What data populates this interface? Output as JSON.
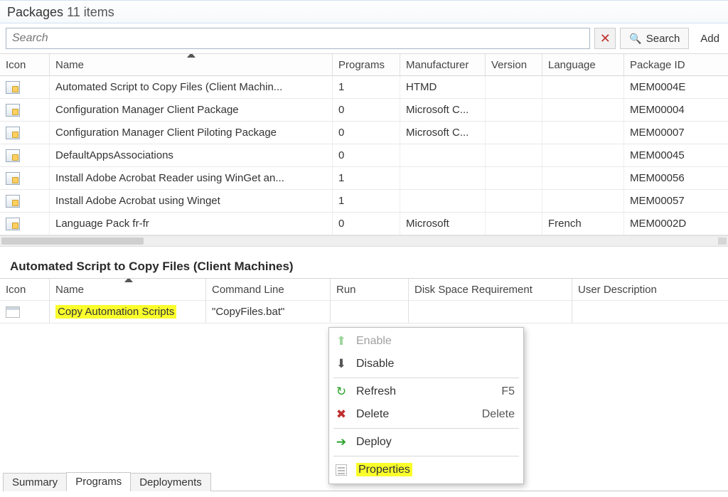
{
  "header": {
    "title": "Packages",
    "count_label": "11 items"
  },
  "search": {
    "placeholder": "Search",
    "clear_icon": "✕",
    "search_button": "Search",
    "add_link": "Add"
  },
  "columns": {
    "icon": "Icon",
    "name": "Name",
    "programs": "Programs",
    "manufacturer": "Manufacturer",
    "version": "Version",
    "language": "Language",
    "package_id": "Package ID"
  },
  "packages": [
    {
      "name": "Automated Script to Copy Files (Client Machin...",
      "programs": "1",
      "manufacturer": "HTMD",
      "version": "",
      "language": "",
      "package_id": "MEM0004E"
    },
    {
      "name": "Configuration Manager Client Package",
      "programs": "0",
      "manufacturer": "Microsoft C...",
      "version": "",
      "language": "",
      "package_id": "MEM00004"
    },
    {
      "name": "Configuration Manager Client Piloting Package",
      "programs": "0",
      "manufacturer": "Microsoft C...",
      "version": "",
      "language": "",
      "package_id": "MEM00007"
    },
    {
      "name": "DefaultAppsAssociations",
      "programs": "0",
      "manufacturer": "",
      "version": "",
      "language": "",
      "package_id": "MEM00045"
    },
    {
      "name": "Install Adobe Acrobat Reader using WinGet an...",
      "programs": "1",
      "manufacturer": "",
      "version": "",
      "language": "",
      "package_id": "MEM00056"
    },
    {
      "name": "Install Adobe Acrobat using Winget",
      "programs": "1",
      "manufacturer": "",
      "version": "",
      "language": "",
      "package_id": "MEM00057"
    },
    {
      "name": "Language Pack fr-fr",
      "programs": "0",
      "manufacturer": "Microsoft",
      "version": "",
      "language": "French",
      "package_id": "MEM0002D"
    }
  ],
  "detail": {
    "title": "Automated Script to Copy Files (Client Machines)"
  },
  "program_columns": {
    "icon": "Icon",
    "name": "Name",
    "command": "Command Line",
    "run": "Run",
    "disk": "Disk Space Requirement",
    "user_desc": "User Description"
  },
  "programs": [
    {
      "name": "Copy Automation Scripts",
      "command": "\"CopyFiles.bat\"",
      "run": "",
      "disk": "",
      "user_desc": ""
    }
  ],
  "tabs": {
    "summary": "Summary",
    "programs": "Programs",
    "deployments": "Deployments"
  },
  "context_menu": {
    "enable": "Enable",
    "disable": "Disable",
    "refresh": "Refresh",
    "refresh_accel": "F5",
    "delete": "Delete",
    "delete_accel": "Delete",
    "deploy": "Deploy",
    "properties": "Properties"
  }
}
